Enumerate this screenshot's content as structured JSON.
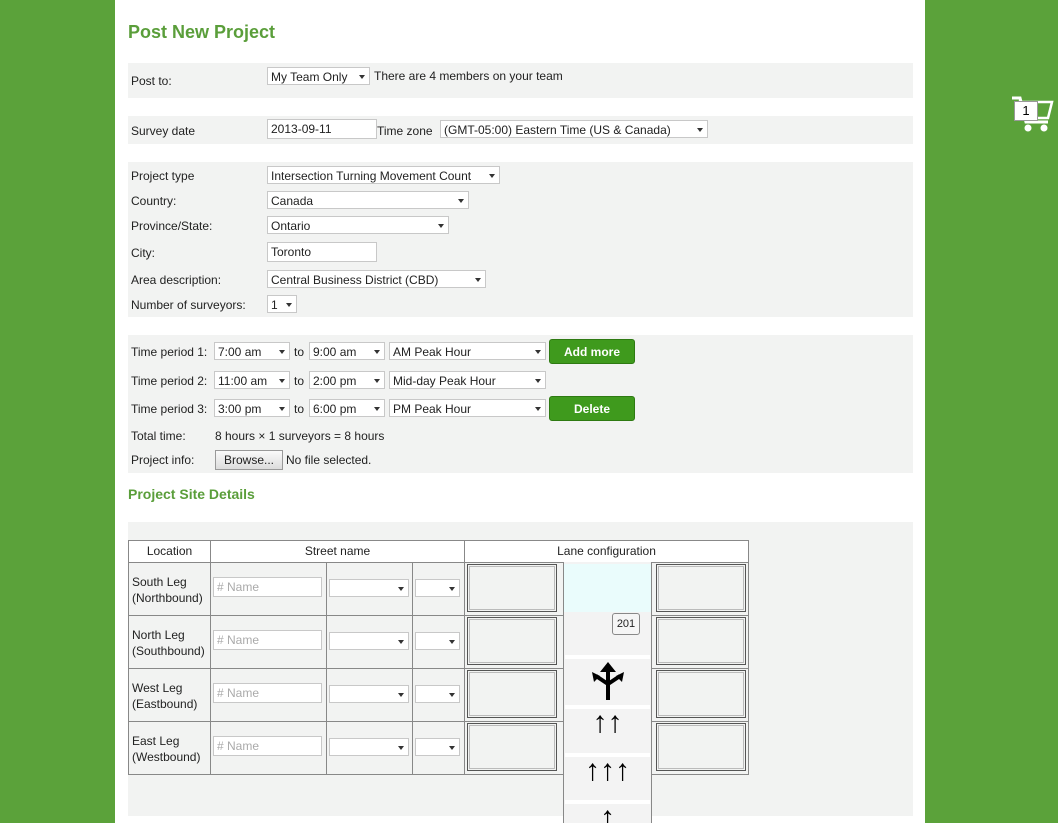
{
  "title": "Post New Project",
  "cart": {
    "count": "1"
  },
  "post_to": {
    "label": "Post to:",
    "value": "My Team Only",
    "note": "There are 4 members on your team"
  },
  "survey": {
    "date_label": "Survey date",
    "date_value": "2013-09-11",
    "tz_label": "Time zone",
    "tz_value": "(GMT-05:00) Eastern Time (US & Canada)"
  },
  "project": {
    "type_label": "Project type",
    "type_value": "Intersection Turning Movement Count",
    "country_label": "Country:",
    "country_value": "Canada",
    "province_label": "Province/State:",
    "province_value": "Ontario",
    "city_label": "City:",
    "city_value": "Toronto",
    "area_label": "Area description:",
    "area_value": "Central Business District (CBD)",
    "surveyors_label": "Number of surveyors:",
    "surveyors_value": "1"
  },
  "periods": [
    {
      "label": "Time period 1:",
      "from": "7:00 am",
      "to_word": "to",
      "to": "9:00 am",
      "name": "AM Peak Hour",
      "button": "Add more"
    },
    {
      "label": "Time period 2:",
      "from": "11:00 am",
      "to_word": "to",
      "to": "2:00 pm",
      "name": "Mid-day Peak Hour"
    },
    {
      "label": "Time period 3:",
      "from": "3:00 pm",
      "to_word": "to",
      "to": "6:00 pm",
      "name": "PM Peak Hour",
      "button": "Delete"
    }
  ],
  "total": {
    "label": "Total time:",
    "value": "8 hours × 1 surveyors = 8 hours"
  },
  "info": {
    "label": "Project info:",
    "button": "Browse...",
    "status": "No file selected."
  },
  "site": {
    "heading": "Project Site Details",
    "headers": {
      "location": "Location",
      "street": "Street name",
      "lane": "Lane configuration"
    },
    "name_placeholder": "# Name",
    "rows": [
      {
        "line1": "South Leg",
        "line2": "(Northbound)"
      },
      {
        "line1": "North Leg",
        "line2": "(Southbound)"
      },
      {
        "line1": "West Leg",
        "line2": "(Eastbound)"
      },
      {
        "line1": "East Leg",
        "line2": "(Westbound)"
      }
    ],
    "tooltip": "201",
    "lane_icons": [
      "⬆",
      "↑↑",
      "↑↑↑",
      "↑"
    ]
  }
}
